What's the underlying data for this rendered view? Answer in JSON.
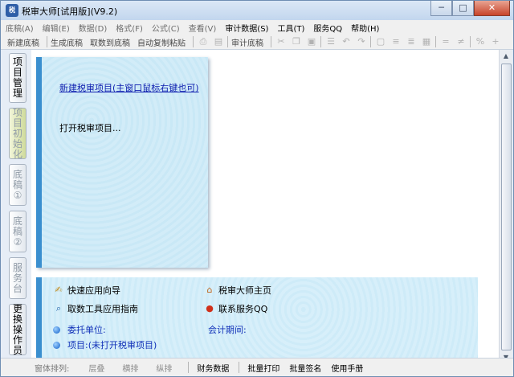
{
  "window": {
    "app_icon_text": "税",
    "title": "税审大师[试用版](V9.2)",
    "buttons": {
      "minimize": "─",
      "maximize": "□",
      "close": "✕"
    }
  },
  "menubar": {
    "items": [
      {
        "label": "底稿(A)",
        "enabled": false
      },
      {
        "label": "编辑(E)",
        "enabled": false
      },
      {
        "label": "数据(D)",
        "enabled": false
      },
      {
        "label": "格式(F)",
        "enabled": false
      },
      {
        "label": "公式(C)",
        "enabled": false
      },
      {
        "label": "查看(V)",
        "enabled": false
      },
      {
        "label": "审计数据(S)",
        "enabled": true
      },
      {
        "label": "工具(T)",
        "enabled": true
      },
      {
        "label": "服务QQ",
        "enabled": true
      },
      {
        "label": "帮助(H)",
        "enabled": true
      }
    ]
  },
  "toolbar": {
    "new_draft": "新建底稿",
    "generate_draft": "生成底稿",
    "fetch_to_draft": "取数到底稿",
    "auto_copy_paste": "自动复制粘贴",
    "audit_draft": "审计底稿"
  },
  "sidebar": {
    "tabs": [
      {
        "label": "项目管理",
        "state": "active"
      },
      {
        "label": "项目初始化",
        "state": "off"
      },
      {
        "label": "底稿①",
        "state": "off"
      },
      {
        "label": "底稿②",
        "state": "off"
      },
      {
        "label": "服务台",
        "state": "off"
      },
      {
        "label": "更换操作员",
        "state": "active"
      }
    ]
  },
  "main": {
    "new_project_link": "新建税审项目(主窗口鼠标右键也可)",
    "open_project": "打开税审项目...",
    "quick_guide": "快速应用向导",
    "homepage": "税审大师主页",
    "fetch_tool_guide": "取数工具应用指南",
    "contact_qq": "联系服务QQ",
    "client_label": "委托单位:",
    "period_label": "会计期间:",
    "project_label": "项目:",
    "project_value": "(未打开税审项目)"
  },
  "bottombar": {
    "window_arrange": "窗体排列:",
    "cascade": "层叠",
    "tile_horizontal": "横排",
    "tile_vertical": "纵排",
    "financial_data": "财务数据",
    "batch_print": "批量打印",
    "batch_sign": "批量签名",
    "user_manual": "使用手册"
  },
  "colors": {
    "accent": "#3a8fcf",
    "link": "#1020b0",
    "info_text": "#1030b8"
  }
}
